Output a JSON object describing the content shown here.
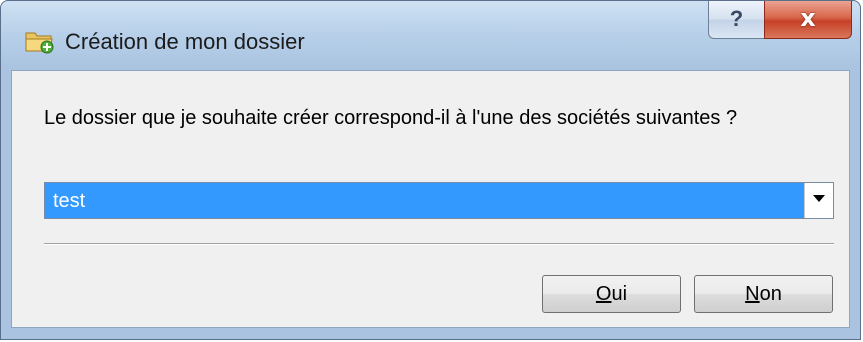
{
  "window": {
    "title": "Création de mon dossier",
    "help_label": "?",
    "close_label": "x"
  },
  "dialog": {
    "question": "Le dossier que je souhaite créer correspond-il à l'une des sociétés suivantes ?",
    "company_select": {
      "selected_value": "test"
    },
    "buttons": {
      "yes": {
        "mnemonic": "O",
        "rest": "ui"
      },
      "no": {
        "mnemonic": "N",
        "rest": "on"
      }
    }
  },
  "colors": {
    "selection": "#3399ff",
    "close_button": "#c74127",
    "dialog_background": "#f0f0f0"
  },
  "icons": {
    "title": "folder-add-icon",
    "combo": "chevron-down-icon"
  }
}
